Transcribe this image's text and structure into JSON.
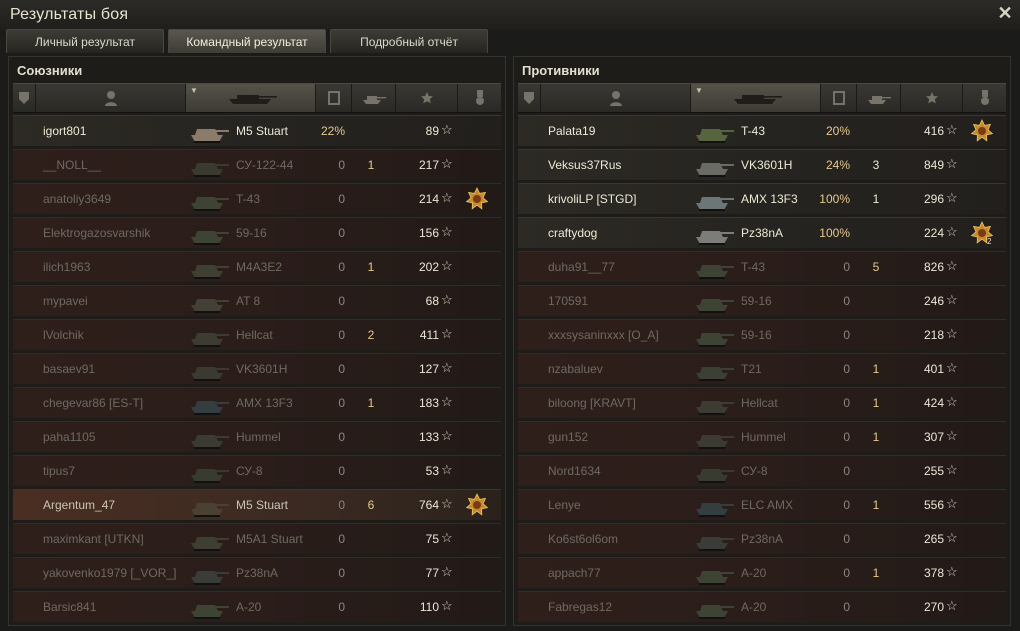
{
  "window": {
    "title": "Результаты боя"
  },
  "tabs": [
    {
      "label": "Личный результат",
      "active": false
    },
    {
      "label": "Командный результат",
      "active": true
    },
    {
      "label": "Подробный отчёт",
      "active": false
    }
  ],
  "allies": {
    "title": "Союзники",
    "rows": [
      {
        "name": "igort801",
        "tank": "M5 Stuart",
        "dmg": "22%",
        "frags": "",
        "xp": "89",
        "medal": false,
        "state": "alive",
        "tank_color": "#8b7b6a"
      },
      {
        "name": "__NOLL__",
        "tank": "СУ-122-44",
        "dmg": "0",
        "frags": "1",
        "xp": "217",
        "medal": false,
        "state": "dead",
        "tank_color": "#3b3a30"
      },
      {
        "name": "anatoliy3649",
        "tank": "T-43",
        "dmg": "0",
        "frags": "",
        "xp": "214",
        "medal": true,
        "state": "dead",
        "tank_color": "#3d4434"
      },
      {
        "name": "Elektrogazosvarshik",
        "tank": "59-16",
        "dmg": "0",
        "frags": "",
        "xp": "156",
        "medal": false,
        "state": "dead",
        "tank_color": "#3e4433"
      },
      {
        "name": "ilich1963",
        "tank": "M4A3E2",
        "dmg": "0",
        "frags": "1",
        "xp": "202",
        "medal": false,
        "state": "dead",
        "tank_color": "#404032"
      },
      {
        "name": "mypavei",
        "tank": "AT 8",
        "dmg": "0",
        "frags": "",
        "xp": "68",
        "medal": false,
        "state": "dead",
        "tank_color": "#434135"
      },
      {
        "name": "lVolchik",
        "tank": "Hellcat",
        "dmg": "0",
        "frags": "2",
        "xp": "411",
        "medal": false,
        "state": "dead",
        "tank_color": "#3c3c33"
      },
      {
        "name": "basaev91",
        "tank": "VK3601H",
        "dmg": "0",
        "frags": "",
        "xp": "127",
        "medal": false,
        "state": "dead",
        "tank_color": "#3a3a33"
      },
      {
        "name": "chegevar86 [ES-T]",
        "tank": "AMX 13F3",
        "dmg": "0",
        "frags": "1",
        "xp": "183",
        "medal": false,
        "state": "dead",
        "tank_color": "#343d3f"
      },
      {
        "name": "paha1105",
        "tank": "Hummel",
        "dmg": "0",
        "frags": "",
        "xp": "133",
        "medal": false,
        "state": "dead",
        "tank_color": "#3b3b34"
      },
      {
        "name": "tipus7",
        "tank": "СУ-8",
        "dmg": "0",
        "frags": "",
        "xp": "53",
        "medal": false,
        "state": "dead",
        "tank_color": "#383c30"
      },
      {
        "name": "Argentum_47",
        "tank": "M5 Stuart",
        "dmg": "0",
        "frags": "6",
        "xp": "764",
        "medal": true,
        "state": "self",
        "tank_color": "#4a4133"
      },
      {
        "name": "maximkant [UTKN]",
        "tank": "M5A1 Stuart",
        "dmg": "0",
        "frags": "",
        "xp": "75",
        "medal": false,
        "state": "dead",
        "tank_color": "#3e3e33"
      },
      {
        "name": "yakovenko1979 [_VOR_]",
        "tank": "Pz38nA",
        "dmg": "0",
        "frags": "",
        "xp": "77",
        "medal": false,
        "state": "dead",
        "tank_color": "#3a3c3a"
      },
      {
        "name": "Barsic841",
        "tank": "A-20",
        "dmg": "0",
        "frags": "",
        "xp": "110",
        "medal": false,
        "state": "dead",
        "tank_color": "#3e4434"
      }
    ]
  },
  "enemies": {
    "title": "Противники",
    "rows": [
      {
        "name": "Palata19",
        "tank": "T-43",
        "dmg": "20%",
        "frags": "",
        "xp": "416",
        "medal": true,
        "state": "alive",
        "tank_color": "#56653e"
      },
      {
        "name": "Veksus37Rus",
        "tank": "VK3601H",
        "dmg": "24%",
        "frags": "3",
        "xp": "849",
        "medal": false,
        "state": "alive",
        "tank_color": "#6b6b66"
      },
      {
        "name": "krivoliLP [STGD]",
        "tank": "AMX 13F3",
        "dmg": "100%",
        "frags": "1",
        "xp": "296",
        "medal": false,
        "state": "alive",
        "tank_color": "#6c7677"
      },
      {
        "name": "craftydog",
        "tank": "Pz38nA",
        "dmg": "100%",
        "frags": "",
        "xp": "224",
        "medal": true,
        "medal_count": "2",
        "state": "alive",
        "tank_color": "#7c7c78"
      },
      {
        "name": "duha91__77",
        "tank": "T-43",
        "dmg": "0",
        "frags": "5",
        "xp": "826",
        "medal": false,
        "state": "dead",
        "tank_color": "#3d4434"
      },
      {
        "name": "170591",
        "tank": "59-16",
        "dmg": "0",
        "frags": "",
        "xp": "246",
        "medal": false,
        "state": "dead",
        "tank_color": "#3e4433"
      },
      {
        "name": "xxxsysaninxxx [O_A]",
        "tank": "59-16",
        "dmg": "0",
        "frags": "",
        "xp": "218",
        "medal": false,
        "state": "dead",
        "tank_color": "#3e4433"
      },
      {
        "name": "nzabaluev",
        "tank": "T21",
        "dmg": "0",
        "frags": "1",
        "xp": "401",
        "medal": false,
        "state": "dead",
        "tank_color": "#3c3f33"
      },
      {
        "name": "biloong [KRAVT]",
        "tank": "Hellcat",
        "dmg": "0",
        "frags": "1",
        "xp": "424",
        "medal": false,
        "state": "dead",
        "tank_color": "#3c3c33"
      },
      {
        "name": "gun152",
        "tank": "Hummel",
        "dmg": "0",
        "frags": "1",
        "xp": "307",
        "medal": false,
        "state": "dead",
        "tank_color": "#3b3b34"
      },
      {
        "name": "Nord1634",
        "tank": "СУ-8",
        "dmg": "0",
        "frags": "",
        "xp": "255",
        "medal": false,
        "state": "dead",
        "tank_color": "#383c30"
      },
      {
        "name": "Lenye",
        "tank": "ELC AMX",
        "dmg": "0",
        "frags": "1",
        "xp": "556",
        "medal": false,
        "state": "dead",
        "tank_color": "#343d3f"
      },
      {
        "name": "Ko6st6ol6om",
        "tank": "Pz38nA",
        "dmg": "0",
        "frags": "",
        "xp": "265",
        "medal": false,
        "state": "dead",
        "tank_color": "#3a3c3a"
      },
      {
        "name": "appach77",
        "tank": "A-20",
        "dmg": "0",
        "frags": "1",
        "xp": "378",
        "medal": false,
        "state": "dead",
        "tank_color": "#3e4434"
      },
      {
        "name": "Fabregas12",
        "tank": "A-20",
        "dmg": "0",
        "frags": "",
        "xp": "270",
        "medal": false,
        "state": "dead",
        "tank_color": "#3e4434"
      }
    ]
  },
  "column_icons": [
    "platoon-icon",
    "player-icon",
    "tank-icon",
    "damage-icon",
    "frags-icon",
    "xp-star-icon",
    "medal-icon"
  ],
  "icons": {
    "star": "☆",
    "close": "✕"
  },
  "colors": {
    "accent": "#e4c98f",
    "alive_text": "#ede9d6",
    "dead_text": "#6f6a60"
  }
}
